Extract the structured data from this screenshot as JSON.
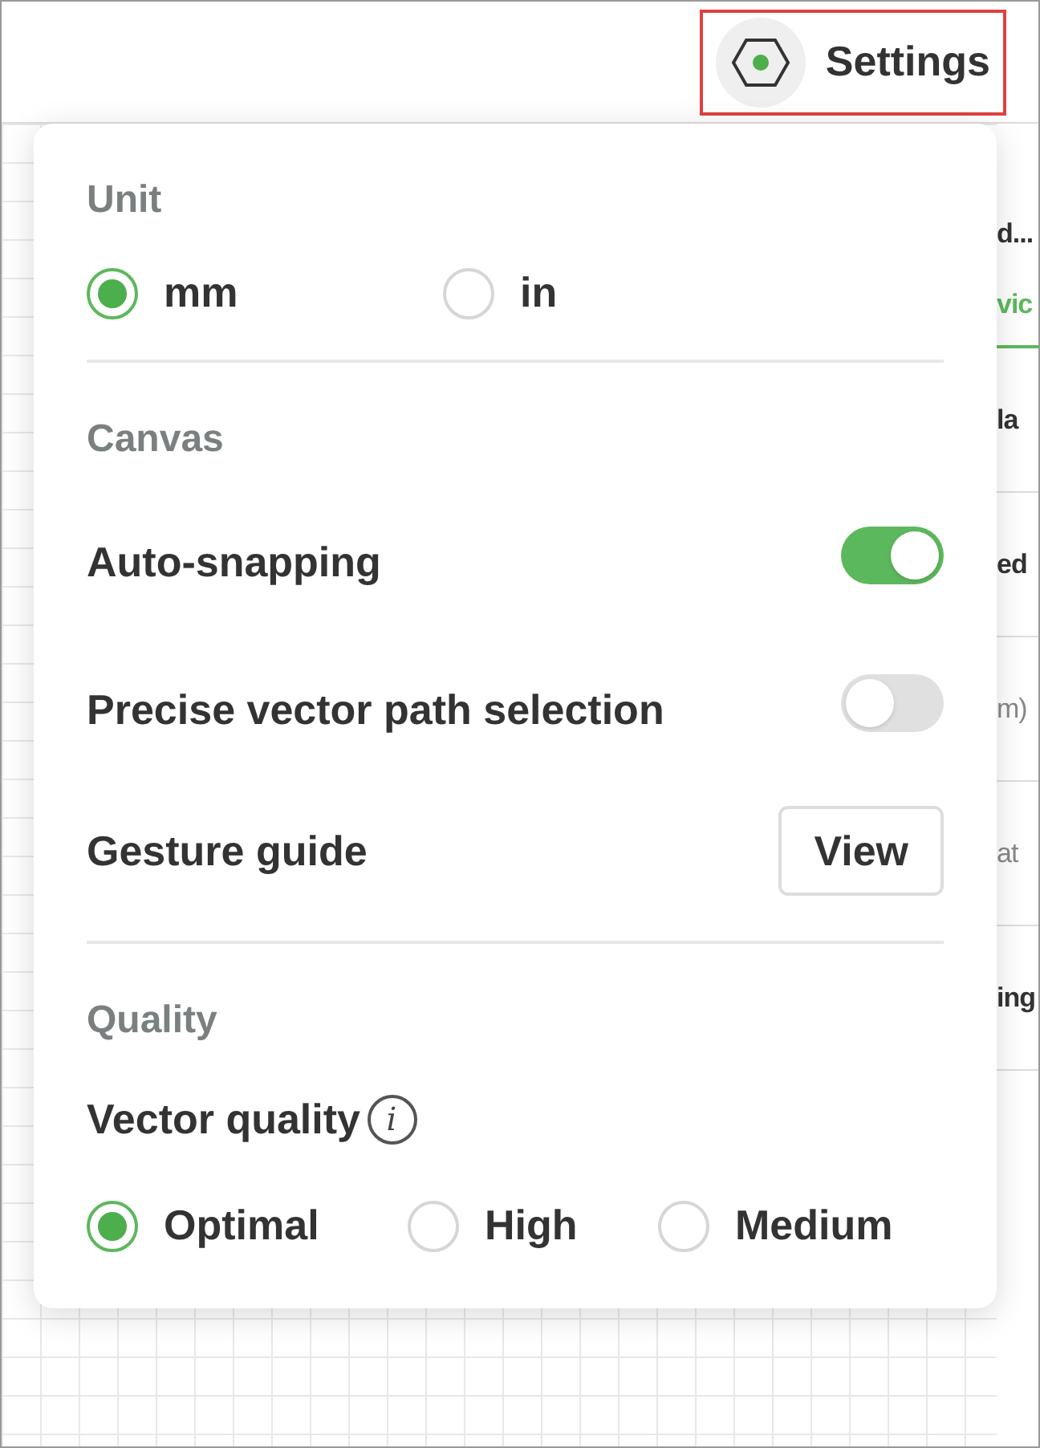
{
  "header": {
    "settings_button": {
      "label": "Settings",
      "highlighted": true
    }
  },
  "background_panel": {
    "fragments": [
      {
        "text": "d...",
        "kind": "title"
      },
      {
        "text": "vic",
        "kind": "tab"
      },
      {
        "text": "la",
        "kind": "row"
      },
      {
        "text": "ed",
        "kind": "row"
      },
      {
        "text": "m)",
        "kind": "muted"
      },
      {
        "text": "at",
        "kind": "muted"
      },
      {
        "text": "ing",
        "kind": "row"
      }
    ]
  },
  "settings_popover": {
    "sections": [
      {
        "title": "Unit",
        "items": [
          {
            "kind": "radio_group",
            "options": [
              {
                "label": "mm",
                "selected": true
              },
              {
                "label": "in",
                "selected": false
              }
            ]
          }
        ]
      },
      {
        "title": "Canvas",
        "items": [
          {
            "kind": "toggle",
            "label": "Auto-snapping",
            "on": true
          },
          {
            "kind": "toggle",
            "label": "Precise vector path selection",
            "on": false
          },
          {
            "kind": "button",
            "label": "Gesture guide",
            "button": "View"
          }
        ]
      },
      {
        "title": "Quality",
        "items": [
          {
            "kind": "info_label",
            "label": "Vector quality",
            "icon": "i"
          },
          {
            "kind": "radio_group",
            "options": [
              {
                "label": "Optimal",
                "selected": true
              },
              {
                "label": "High",
                "selected": false
              },
              {
                "label": "Medium",
                "selected": false
              }
            ]
          }
        ]
      }
    ]
  }
}
